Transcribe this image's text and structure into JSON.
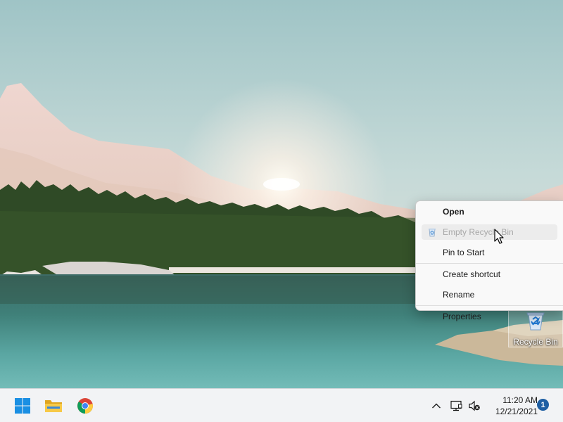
{
  "desktop": {
    "icons": [
      {
        "label": "Recycle Bin",
        "icon": "recycle-bin-icon"
      }
    ]
  },
  "context_menu": {
    "items": [
      {
        "label": "Open",
        "bold": true,
        "disabled": false
      },
      {
        "label": "Empty Recycle Bin",
        "disabled": true,
        "icon": "recycle-bin-icon"
      },
      {
        "label": "Pin to Start",
        "disabled": false
      },
      {
        "label": "Create shortcut",
        "disabled": false
      },
      {
        "label": "Rename",
        "disabled": false
      },
      {
        "label": "Properties",
        "disabled": false
      }
    ]
  },
  "taskbar": {
    "apps": [
      {
        "name": "Start",
        "icon": "windows-start-icon"
      },
      {
        "name": "File Explorer",
        "icon": "folder-icon"
      },
      {
        "name": "Google Chrome",
        "icon": "chrome-icon"
      }
    ],
    "tray": {
      "icons": [
        "chevron-up-icon",
        "network-icon",
        "volume-muted-icon"
      ],
      "time": "11:20 AM",
      "date": "12/21/2021",
      "notification_count": "1"
    }
  },
  "colors": {
    "accent": "#0078d4",
    "taskbar_bg": "#f2f3f5",
    "menu_bg": "#f9f9f9",
    "disabled_text": "#a8a8a8",
    "badge": "#1f5fa3"
  }
}
